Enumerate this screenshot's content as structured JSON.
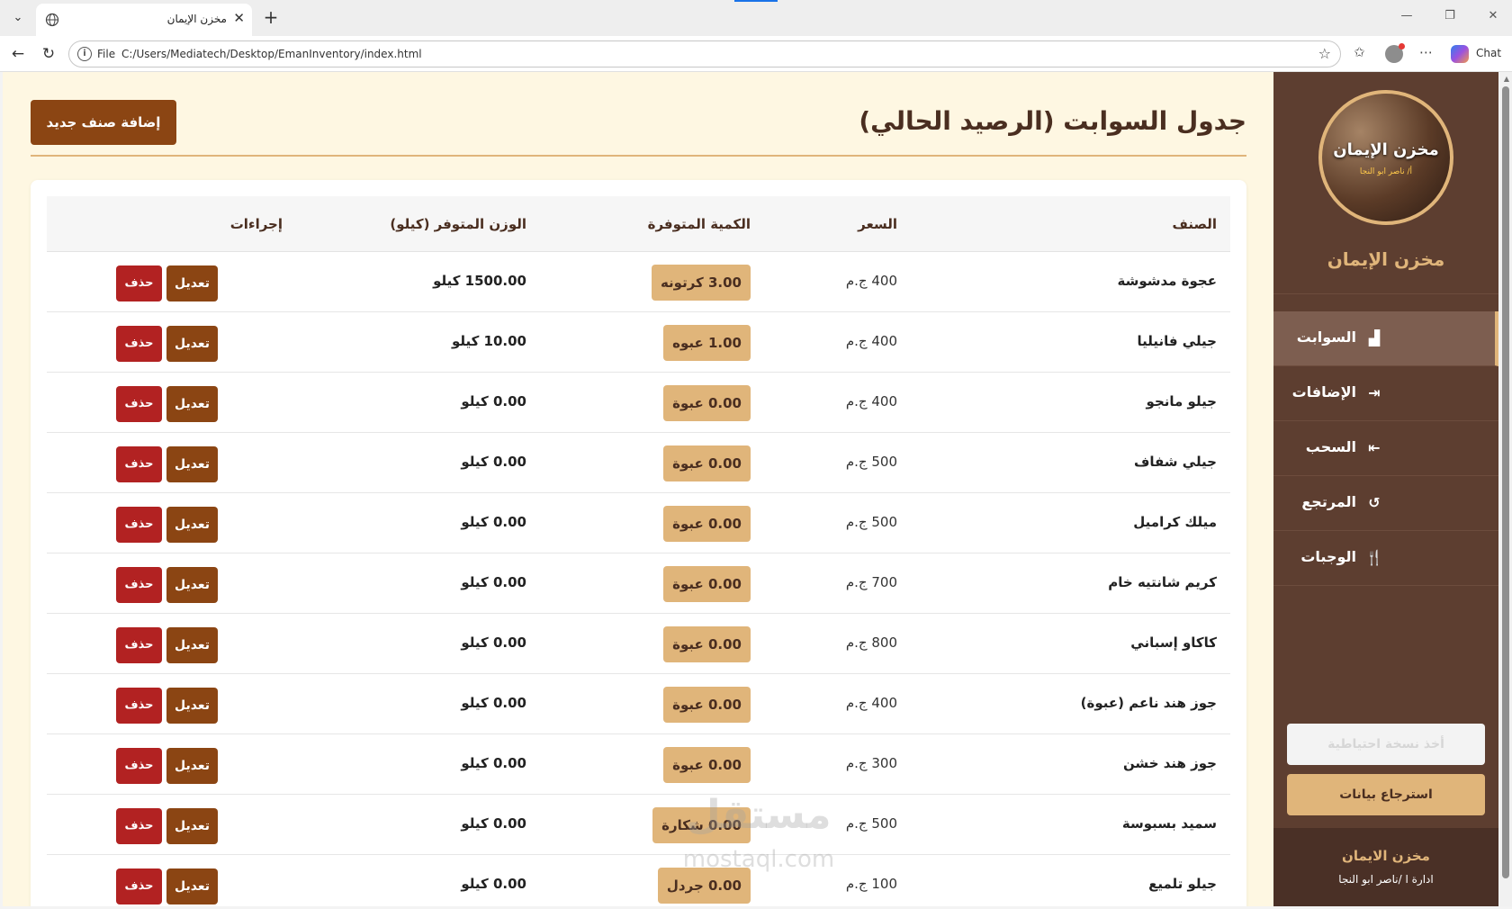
{
  "browser": {
    "tab_title": "مخزن الإيمان",
    "tab_close": "✕",
    "new_tab": "+",
    "url_scheme": "File",
    "url": "C:/Users/Mediatech/Desktop/EmanInventory/index.html",
    "chat_label": "Chat"
  },
  "sidebar": {
    "logo_title": "مخزن الإيمان",
    "logo_subtitle": "أ/ ناصر ابو النجا",
    "brand_name": "مخزن الإيمان",
    "nav": [
      {
        "label": "السوابت",
        "icon": "warehouse-icon",
        "glyph": "▟",
        "active": true
      },
      {
        "label": "الإضافات",
        "icon": "sign-in-icon",
        "glyph": "⇥",
        "active": false
      },
      {
        "label": "السحب",
        "icon": "sign-out-icon",
        "glyph": "⇤",
        "active": false
      },
      {
        "label": "المرتجع",
        "icon": "undo-icon",
        "glyph": "↺",
        "active": false
      },
      {
        "label": "الوجبات",
        "icon": "utensils-icon",
        "glyph": "🍴",
        "active": false
      }
    ],
    "backup_label": "أخذ نسخة احتياطية",
    "restore_label": "استرجاع بيانات",
    "footer_name": "مخزن الايمان",
    "footer_by": "ادارة ا /ناصر ابو النجا"
  },
  "main": {
    "title": "جدول السوابت (الرصيد الحالي)",
    "add_button": "إضافة صنف جديد",
    "table": {
      "headers": {
        "name": "الصنف",
        "price": "السعر",
        "qty": "الكمية المتوفرة",
        "weight": "الوزن المتوفر (كيلو)",
        "actions": "إجراءات"
      },
      "edit_label": "تعديل",
      "delete_label": "حذف",
      "rows": [
        {
          "name": "عجوة مدشوشة",
          "price": "400 ج.م",
          "qty": "3.00 كرتونه",
          "weight": "1500.00 كيلو"
        },
        {
          "name": "جيلي فانيليا",
          "price": "400 ج.م",
          "qty": "1.00 عبوه",
          "weight": "10.00 كيلو"
        },
        {
          "name": "جيلو مانجو",
          "price": "400 ج.م",
          "qty": "0.00 عبوة",
          "weight": "0.00 كيلو"
        },
        {
          "name": "جيلي شفاف",
          "price": "500 ج.م",
          "qty": "0.00 عبوة",
          "weight": "0.00 كيلو"
        },
        {
          "name": "ميلك كراميل",
          "price": "500 ج.م",
          "qty": "0.00 عبوة",
          "weight": "0.00 كيلو"
        },
        {
          "name": "كريم شانتيه خام",
          "price": "700 ج.م",
          "qty": "0.00 عبوة",
          "weight": "0.00 كيلو"
        },
        {
          "name": "كاكاو إسباني",
          "price": "800 ج.م",
          "qty": "0.00 عبوة",
          "weight": "0.00 كيلو"
        },
        {
          "name": "جوز هند ناعم (عبوة)",
          "price": "400 ج.م",
          "qty": "0.00 عبوة",
          "weight": "0.00 كيلو"
        },
        {
          "name": "جوز هند خشن",
          "price": "300 ج.م",
          "qty": "0.00 عبوة",
          "weight": "0.00 كيلو"
        },
        {
          "name": "سميد بسبوسة",
          "price": "500 ج.م",
          "qty": "0.00 شكارة",
          "weight": "0.00 كيلو"
        },
        {
          "name": "جيلو تلميع",
          "price": "100 ج.م",
          "qty": "0.00 جردل",
          "weight": "0.00 كيلو"
        }
      ]
    }
  },
  "watermark": {
    "text": "مستقل",
    "sub": "mostaql.com"
  },
  "colors": {
    "sidebar_bg": "#5d3e30",
    "accent": "#e0b57a",
    "primary_button": "#8b4513",
    "danger_button": "#b22222",
    "main_bg": "#fef7e2"
  }
}
